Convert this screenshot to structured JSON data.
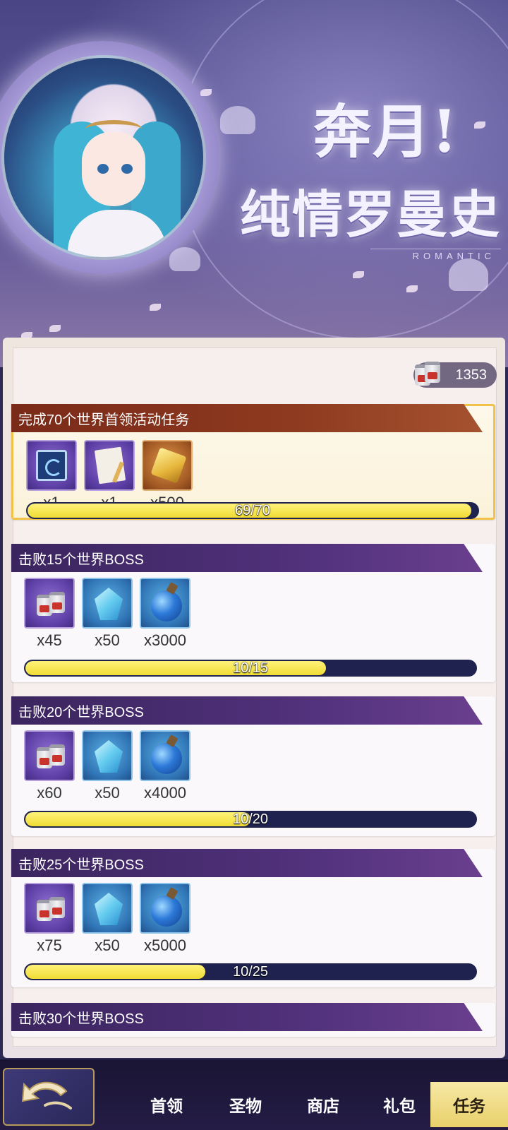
{
  "banner": {
    "title_line1": "奔月!",
    "title_line2": "纯情罗曼史",
    "subtitle": "ROMANTIC"
  },
  "currency": {
    "icon": "can-bundle-icon",
    "amount": "1353"
  },
  "tasks": [
    {
      "title": "完成70个世界首领活动任务",
      "highlight": true,
      "rewards": [
        {
          "icon": "map-icon",
          "qty": "x1"
        },
        {
          "icon": "letter-icon",
          "qty": "x1"
        },
        {
          "icon": "gold-gem-icon",
          "qty": "x500"
        }
      ],
      "progress_text": "69/70",
      "progress": 0.986
    },
    {
      "title": "击败15个世界BOSS",
      "rewards": [
        {
          "icon": "can-bundle-icon",
          "qty": "x45"
        },
        {
          "icon": "blue-crystal-icon",
          "qty": "x50"
        },
        {
          "icon": "potion-icon",
          "qty": "x3000"
        }
      ],
      "progress_text": "10/15",
      "progress": 0.667
    },
    {
      "title": "击败20个世界BOSS",
      "rewards": [
        {
          "icon": "can-bundle-icon",
          "qty": "x60"
        },
        {
          "icon": "blue-crystal-icon",
          "qty": "x50"
        },
        {
          "icon": "potion-icon",
          "qty": "x4000"
        }
      ],
      "progress_text": "10/20",
      "progress": 0.5
    },
    {
      "title": "击败25个世界BOSS",
      "rewards": [
        {
          "icon": "can-bundle-icon",
          "qty": "x75"
        },
        {
          "icon": "blue-crystal-icon",
          "qty": "x50"
        },
        {
          "icon": "potion-icon",
          "qty": "x5000"
        }
      ],
      "progress_text": "10/25",
      "progress": 0.4
    },
    {
      "title": "击败30个世界BOSS"
    }
  ],
  "nav": {
    "items": [
      {
        "label": "首领"
      },
      {
        "label": "圣物"
      },
      {
        "label": "商店"
      },
      {
        "label": "礼包"
      },
      {
        "label": "任务",
        "active": true
      }
    ]
  },
  "colors": {
    "progress_fill": "#f0dc34",
    "progress_track": "#1f214f",
    "header_purple": "#3b255f",
    "header_red": "#7a2a18",
    "highlight_border": "#f0c24a"
  }
}
